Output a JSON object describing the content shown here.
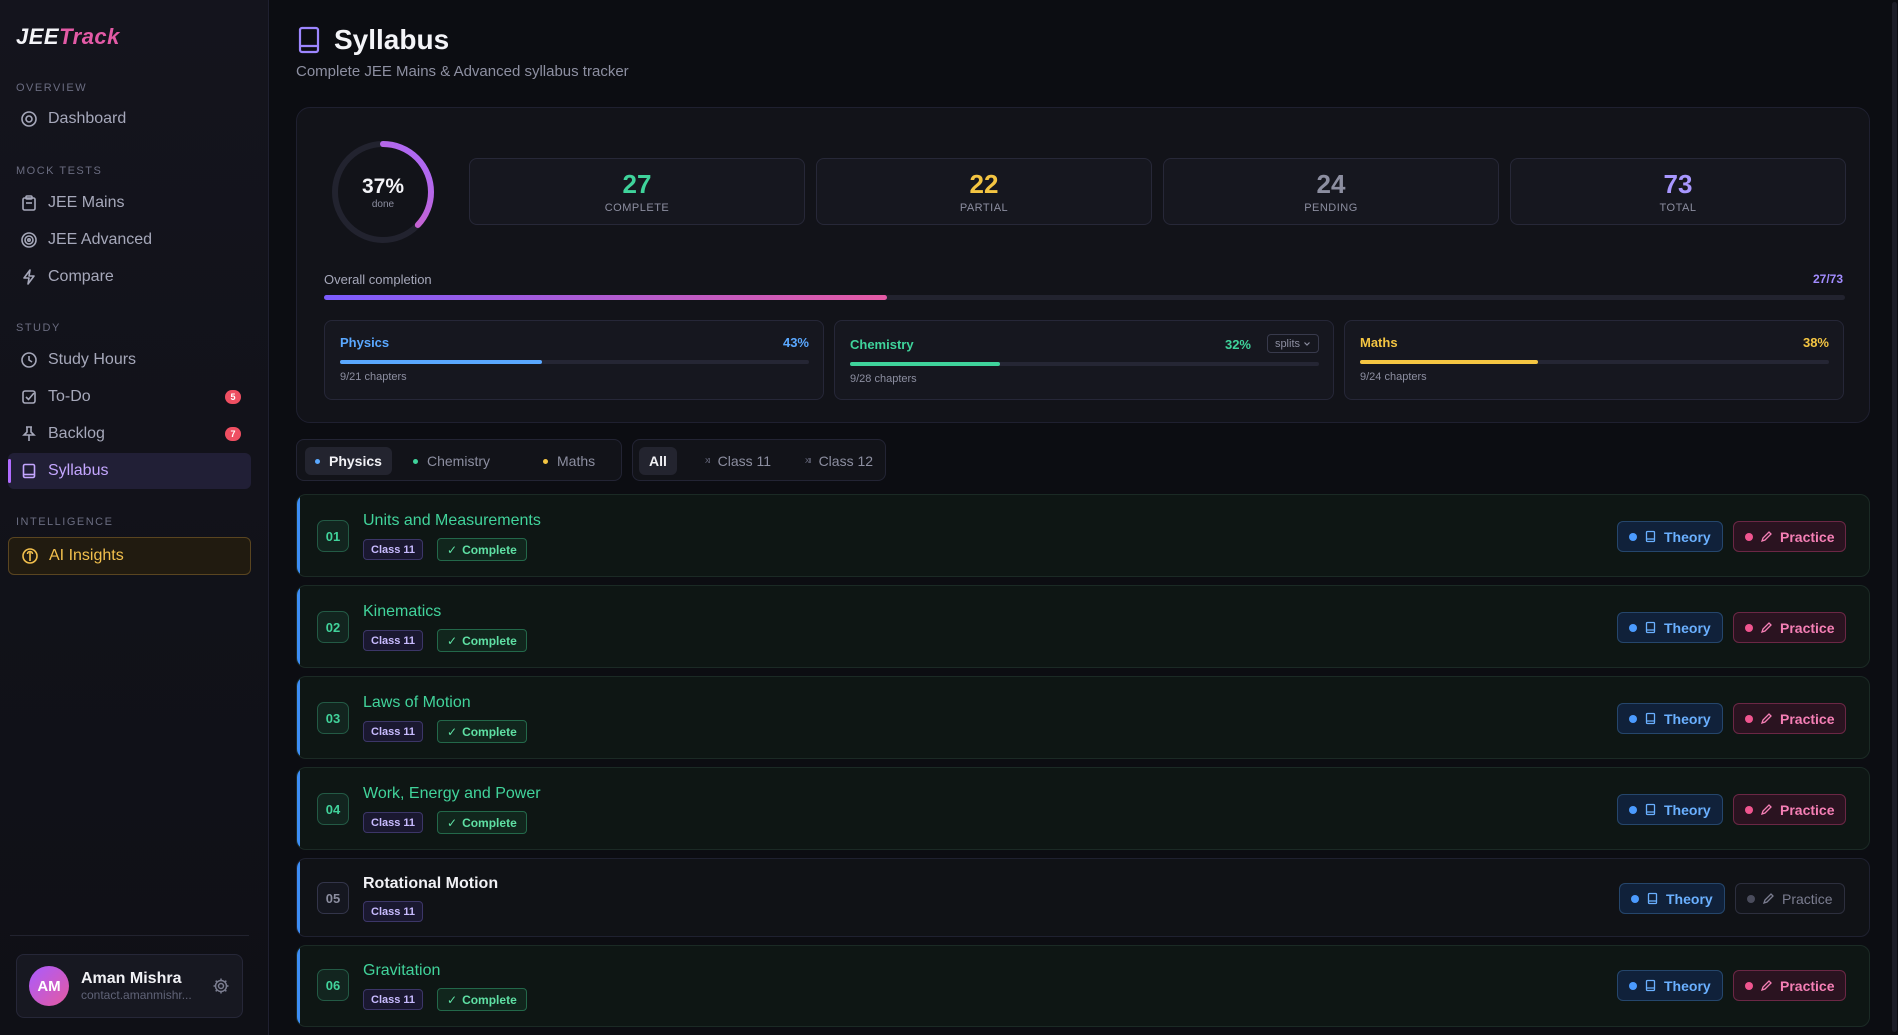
{
  "app": {
    "logo_a": "JEE",
    "logo_b": "Track"
  },
  "sidebar": {
    "sections": {
      "overview": "OVERVIEW",
      "mock": "MOCK TESTS",
      "study": "STUDY",
      "intel": "INTELLIGENCE"
    },
    "items": {
      "dashboard": "Dashboard",
      "jee_mains": "JEE Mains",
      "jee_advanced": "JEE Advanced",
      "compare": "Compare",
      "study_hours": "Study Hours",
      "todo": "To-Do",
      "todo_badge": "5",
      "backlog": "Backlog",
      "backlog_badge": "7",
      "syllabus": "Syllabus",
      "ai_insights": "AI Insights"
    },
    "user": {
      "initials": "AM",
      "name": "Aman Mishra",
      "sub": "contact.amanmishr..."
    }
  },
  "header": {
    "title": "Syllabus",
    "subtitle": "Complete JEE Mains & Advanced syllabus tracker"
  },
  "summary": {
    "percent": "37%",
    "done_label": "done",
    "ring_fraction": 0.37,
    "stats": [
      {
        "value": "27",
        "label": "COMPLETE",
        "color": "#3fd39b"
      },
      {
        "value": "22",
        "label": "PARTIAL",
        "color": "#f4c542"
      },
      {
        "value": "24",
        "label": "PENDING",
        "color": "#8c8ea0"
      },
      {
        "value": "73",
        "label": "TOTAL",
        "color": "#a897ff"
      }
    ],
    "overall_label": "Overall completion",
    "overall_value": "27/73",
    "overall_fraction": 0.37,
    "subjects": [
      {
        "name": "Physics",
        "pct": "43%",
        "fraction": 0.43,
        "chapters": "9/21 chapters",
        "color": "#5aa8ff"
      },
      {
        "name": "Chemistry",
        "pct": "32%",
        "fraction": 0.32,
        "chapters": "9/28 chapters",
        "color": "#3fd39b",
        "splits": "splits"
      },
      {
        "name": "Maths",
        "pct": "38%",
        "fraction": 0.38,
        "chapters": "9/24 chapters",
        "color": "#f4c542"
      }
    ]
  },
  "filters": {
    "subjects": [
      "Physics",
      "Chemistry",
      "Maths"
    ],
    "classes": {
      "all": "All",
      "c11": "Class 11",
      "c12": "Class 12",
      "c11_mark": "XI",
      "c12_mark": "XII"
    }
  },
  "chapters": [
    {
      "no": "01",
      "title": "Units and Measurements",
      "cls": "Class 11",
      "status": "Complete",
      "theory": "Theory",
      "practice": "Practice"
    },
    {
      "no": "02",
      "title": "Kinematics",
      "cls": "Class 11",
      "status": "Complete",
      "theory": "Theory",
      "practice": "Practice"
    },
    {
      "no": "03",
      "title": "Laws of Motion",
      "cls": "Class 11",
      "status": "Complete",
      "theory": "Theory",
      "practice": "Practice"
    },
    {
      "no": "04",
      "title": "Work, Energy and Power",
      "cls": "Class 11",
      "status": "Complete",
      "theory": "Theory",
      "practice": "Practice"
    },
    {
      "no": "05",
      "title": "Rotational Motion",
      "cls": "Class 11",
      "status": "",
      "theory": "Theory",
      "practice": "Practice"
    },
    {
      "no": "06",
      "title": "Gravitation",
      "cls": "Class 11",
      "status": "Complete",
      "theory": "Theory",
      "practice": "Practice"
    }
  ],
  "colors": {
    "accent": "#b06cff",
    "theory": "#6ab0ff",
    "practice": "#f57fb5",
    "complete": "#3fd39b"
  }
}
